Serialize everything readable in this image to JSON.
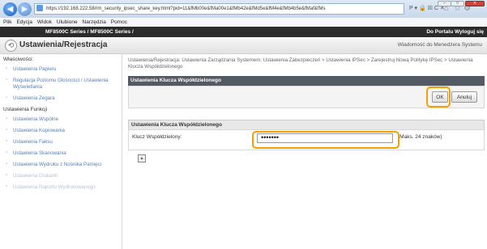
{
  "browser": {
    "url": "https://192.168.222.58/rm_security_ipsec_share_key.html?pid=11&fMb00e&fMa00e1&fMb42e&fMd5e&fM4e&fMb4b5e&fMaf&fMs",
    "tools": "P ▾ 🔒 ☒ C ✕",
    "back": "◀",
    "forward": "▶"
  },
  "menu": [
    "Plik",
    "Edycja",
    "Widok",
    "Ulubione",
    "Narzędzia",
    "Pomoc"
  ],
  "banner": {
    "model": "MF8500C Series / MF8500C Series /",
    "portal": "Do Portalu  Wyloguj się"
  },
  "header": {
    "title": "Ustawienia/Rejestracja",
    "mail": "Wiadomość do Menedżera Systemu"
  },
  "sidebar": {
    "preferences_heading": "Właściwości:",
    "preferences": [
      "Ustawienia Papieru",
      "Regulacja Poziomu Głośności / Ustawienia Wyświetlania",
      "Ustawienia Zegara"
    ],
    "functions_heading": "Ustawienia Funkcji",
    "functions": [
      "Ustawienia Wspólne",
      "Ustawienia Kopiowania",
      "Ustawienia Faksu",
      "Ustawienia Skanowania",
      "Ustawienia Wydruku z Nośnika Pamięci",
      "Ustawienia Drukarki",
      "Ustawienia Raportu Wydrukowanego"
    ]
  },
  "main": {
    "breadcrumb": "Ustawienia/Rejestracja: Ustawienia Zarządzania Systemem: Ustawienia Zabezpieczeń > Ustawienia IPSec > Zarejestruj Nową Politykę IPSec > Ustawienia Klucza Współdzielonego",
    "section_title": "Ustawienia Klucza Współdzielonego",
    "ok_label": "OK",
    "cancel_label": "Anuluj",
    "form_title": "Ustawienia Klucza Współdzielonego",
    "key_label": "Klucz Współdzielony:",
    "key_value": "•••••••",
    "key_hint": "(Maks. 24 znaków)"
  }
}
